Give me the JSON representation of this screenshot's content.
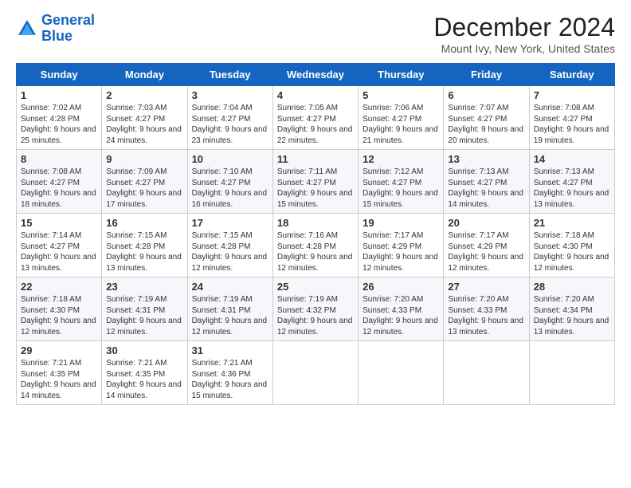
{
  "header": {
    "logo_line1": "General",
    "logo_line2": "Blue",
    "month": "December 2024",
    "location": "Mount Ivy, New York, United States"
  },
  "days_of_week": [
    "Sunday",
    "Monday",
    "Tuesday",
    "Wednesday",
    "Thursday",
    "Friday",
    "Saturday"
  ],
  "weeks": [
    [
      {
        "day": "1",
        "sunrise": "7:02 AM",
        "sunset": "4:28 PM",
        "daylight": "9 hours and 25 minutes."
      },
      {
        "day": "2",
        "sunrise": "7:03 AM",
        "sunset": "4:27 PM",
        "daylight": "9 hours and 24 minutes."
      },
      {
        "day": "3",
        "sunrise": "7:04 AM",
        "sunset": "4:27 PM",
        "daylight": "9 hours and 23 minutes."
      },
      {
        "day": "4",
        "sunrise": "7:05 AM",
        "sunset": "4:27 PM",
        "daylight": "9 hours and 22 minutes."
      },
      {
        "day": "5",
        "sunrise": "7:06 AM",
        "sunset": "4:27 PM",
        "daylight": "9 hours and 21 minutes."
      },
      {
        "day": "6",
        "sunrise": "7:07 AM",
        "sunset": "4:27 PM",
        "daylight": "9 hours and 20 minutes."
      },
      {
        "day": "7",
        "sunrise": "7:08 AM",
        "sunset": "4:27 PM",
        "daylight": "9 hours and 19 minutes."
      }
    ],
    [
      {
        "day": "8",
        "sunrise": "7:08 AM",
        "sunset": "4:27 PM",
        "daylight": "9 hours and 18 minutes."
      },
      {
        "day": "9",
        "sunrise": "7:09 AM",
        "sunset": "4:27 PM",
        "daylight": "9 hours and 17 minutes."
      },
      {
        "day": "10",
        "sunrise": "7:10 AM",
        "sunset": "4:27 PM",
        "daylight": "9 hours and 16 minutes."
      },
      {
        "day": "11",
        "sunrise": "7:11 AM",
        "sunset": "4:27 PM",
        "daylight": "9 hours and 15 minutes."
      },
      {
        "day": "12",
        "sunrise": "7:12 AM",
        "sunset": "4:27 PM",
        "daylight": "9 hours and 15 minutes."
      },
      {
        "day": "13",
        "sunrise": "7:13 AM",
        "sunset": "4:27 PM",
        "daylight": "9 hours and 14 minutes."
      },
      {
        "day": "14",
        "sunrise": "7:13 AM",
        "sunset": "4:27 PM",
        "daylight": "9 hours and 13 minutes."
      }
    ],
    [
      {
        "day": "15",
        "sunrise": "7:14 AM",
        "sunset": "4:27 PM",
        "daylight": "9 hours and 13 minutes."
      },
      {
        "day": "16",
        "sunrise": "7:15 AM",
        "sunset": "4:28 PM",
        "daylight": "9 hours and 13 minutes."
      },
      {
        "day": "17",
        "sunrise": "7:15 AM",
        "sunset": "4:28 PM",
        "daylight": "9 hours and 12 minutes."
      },
      {
        "day": "18",
        "sunrise": "7:16 AM",
        "sunset": "4:28 PM",
        "daylight": "9 hours and 12 minutes."
      },
      {
        "day": "19",
        "sunrise": "7:17 AM",
        "sunset": "4:29 PM",
        "daylight": "9 hours and 12 minutes."
      },
      {
        "day": "20",
        "sunrise": "7:17 AM",
        "sunset": "4:29 PM",
        "daylight": "9 hours and 12 minutes."
      },
      {
        "day": "21",
        "sunrise": "7:18 AM",
        "sunset": "4:30 PM",
        "daylight": "9 hours and 12 minutes."
      }
    ],
    [
      {
        "day": "22",
        "sunrise": "7:18 AM",
        "sunset": "4:30 PM",
        "daylight": "9 hours and 12 minutes."
      },
      {
        "day": "23",
        "sunrise": "7:19 AM",
        "sunset": "4:31 PM",
        "daylight": "9 hours and 12 minutes."
      },
      {
        "day": "24",
        "sunrise": "7:19 AM",
        "sunset": "4:31 PM",
        "daylight": "9 hours and 12 minutes."
      },
      {
        "day": "25",
        "sunrise": "7:19 AM",
        "sunset": "4:32 PM",
        "daylight": "9 hours and 12 minutes."
      },
      {
        "day": "26",
        "sunrise": "7:20 AM",
        "sunset": "4:33 PM",
        "daylight": "9 hours and 12 minutes."
      },
      {
        "day": "27",
        "sunrise": "7:20 AM",
        "sunset": "4:33 PM",
        "daylight": "9 hours and 13 minutes."
      },
      {
        "day": "28",
        "sunrise": "7:20 AM",
        "sunset": "4:34 PM",
        "daylight": "9 hours and 13 minutes."
      }
    ],
    [
      {
        "day": "29",
        "sunrise": "7:21 AM",
        "sunset": "4:35 PM",
        "daylight": "9 hours and 14 minutes."
      },
      {
        "day": "30",
        "sunrise": "7:21 AM",
        "sunset": "4:35 PM",
        "daylight": "9 hours and 14 minutes."
      },
      {
        "day": "31",
        "sunrise": "7:21 AM",
        "sunset": "4:36 PM",
        "daylight": "9 hours and 15 minutes."
      },
      null,
      null,
      null,
      null
    ]
  ]
}
